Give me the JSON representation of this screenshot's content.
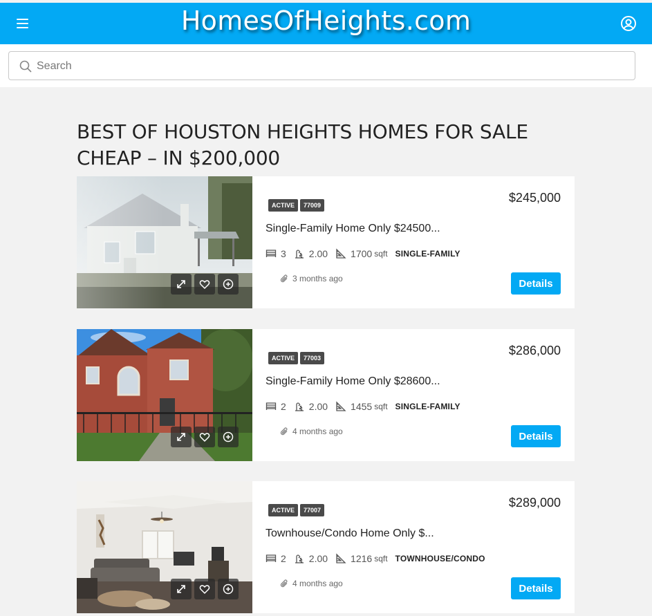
{
  "header": {
    "brand": "HomesOfHeights.com",
    "menu_icon": "hamburger-menu-icon",
    "user_icon": "user-account-icon",
    "accent_color": "#03a9f4"
  },
  "search": {
    "placeholder": "Search",
    "value": "",
    "icon": "search-icon"
  },
  "page": {
    "title": "BEST OF HOUSTON HEIGHTS HOMES FOR SALE CHEAP – IN $200,000"
  },
  "listings": [
    {
      "status": "ACTIVE",
      "zip": "77009",
      "price": "$245,000",
      "title": "Single-Family Home Only $24500...",
      "beds": "3",
      "baths": "2.00",
      "sqft": "1700",
      "sqft_unit": "sqft",
      "type": "SINGLE-FAMILY",
      "posted": "3 months ago",
      "details_label": "Details"
    },
    {
      "status": "ACTIVE",
      "zip": "77003",
      "price": "$286,000",
      "title": "Single-Family Home Only $28600...",
      "beds": "2",
      "baths": "2.00",
      "sqft": "1455",
      "sqft_unit": "sqft",
      "type": "SINGLE-FAMILY",
      "posted": "4 months ago",
      "details_label": "Details"
    },
    {
      "status": "ACTIVE",
      "zip": "77007",
      "price": "$289,000",
      "title": "Townhouse/Condo Home Only $...",
      "beds": "2",
      "baths": "2.00",
      "sqft": "1216",
      "sqft_unit": "sqft",
      "type": "TOWNHOUSE/CONDO",
      "posted": "4 months ago",
      "details_label": "Details"
    }
  ]
}
